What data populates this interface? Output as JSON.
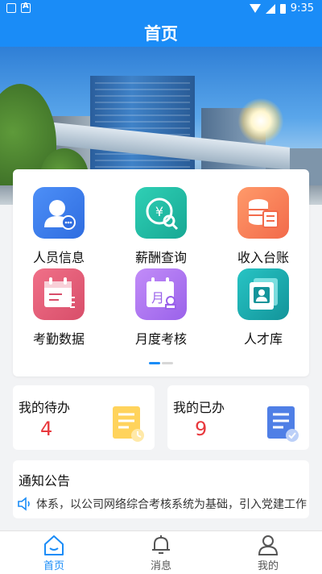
{
  "status_bar": {
    "time": "9:35"
  },
  "header": {
    "title": "首页"
  },
  "menu": {
    "items": [
      {
        "label": "人员信息",
        "icon": "person-info-icon"
      },
      {
        "label": "薪酬查询",
        "icon": "salary-search-icon"
      },
      {
        "label": "收入台账",
        "icon": "income-ledger-icon"
      },
      {
        "label": "考勤数据",
        "icon": "attendance-calendar-icon"
      },
      {
        "label": "月度考核",
        "icon": "monthly-assessment-icon"
      },
      {
        "label": "人才库",
        "icon": "talent-pool-icon"
      }
    ]
  },
  "tasks": {
    "todo": {
      "label": "我的待办",
      "count": "4"
    },
    "done": {
      "label": "我的已办",
      "count": "9"
    }
  },
  "notice": {
    "title": "通知公告",
    "text": "体系，以公司网络综合考核系统为基础，引入党建工作"
  },
  "nav": {
    "items": [
      {
        "label": "首页"
      },
      {
        "label": "消息"
      },
      {
        "label": "我的"
      }
    ]
  },
  "colors": {
    "primary": "#1a8cf7",
    "count": "#e8383d"
  }
}
